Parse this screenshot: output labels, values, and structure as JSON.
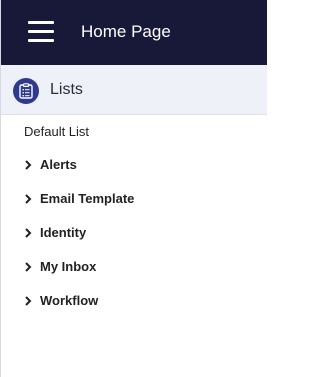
{
  "header": {
    "title": "Home Page"
  },
  "section": {
    "title": "Lists",
    "icon": "clipboard-list-icon"
  },
  "default_list": {
    "label": "Default List"
  },
  "tree": {
    "items": [
      {
        "label": "Alerts",
        "icon": "chevron-right-icon"
      },
      {
        "label": "Email Template",
        "icon": "chevron-right-icon"
      },
      {
        "label": "Identity",
        "icon": "chevron-right-icon"
      },
      {
        "label": "My Inbox",
        "icon": "chevron-right-icon"
      },
      {
        "label": "Workflow",
        "icon": "chevron-right-icon"
      }
    ]
  },
  "colors": {
    "header_bg": "#181838",
    "section_bg": "#eef2f8",
    "accent": "#2f3a8f"
  }
}
